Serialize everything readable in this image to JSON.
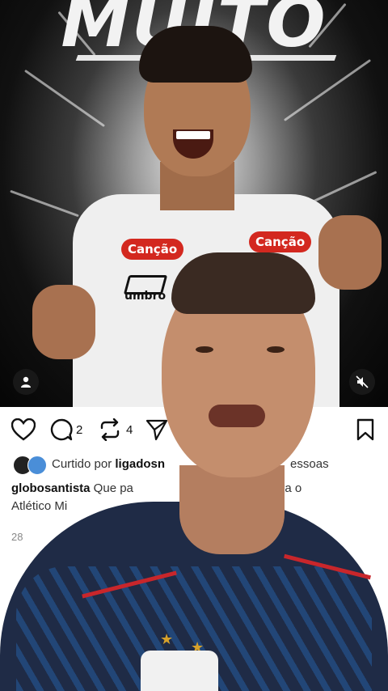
{
  "post_image": {
    "headline": "MUITO",
    "sponsor_left": "Canção",
    "sponsor_right": "Canção",
    "kit_brand": "umbro"
  },
  "actions": {
    "comments_count": "2",
    "reposts_count": "4",
    "like_icon": "heart-icon",
    "comment_icon": "comment-icon",
    "repost_icon": "repost-icon",
    "share_icon": "send-icon",
    "save_icon": "bookmark-icon"
  },
  "likes": {
    "prefix": "Curtido por ",
    "user_visible": "ligadosn",
    "suffix_visible": "essoas"
  },
  "caption": {
    "username": "globosantista",
    "text_start": " Que pa",
    "text_end": " contra o",
    "line2": "Atlético Mi"
  },
  "date_partial": "28",
  "colors": {
    "sponsor_red": "#d3281f",
    "shirt_navy": "#1f2b46",
    "accent_red": "#c8262b"
  }
}
